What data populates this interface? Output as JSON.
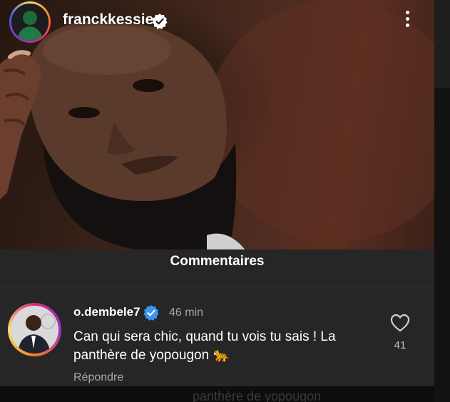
{
  "post": {
    "username": "franckkessie",
    "verified": true,
    "avatar_icon": "profile-avatar",
    "menu_icon": "more-vertical-icon"
  },
  "comments": {
    "title": "Commentaires",
    "items": [
      {
        "username": "o.dembele7",
        "verified": true,
        "time": "46 min",
        "text": "Can qui sera chic, quand tu vois tu sais ! La panthère de yopougon 🐆",
        "reply_label": "Répondre",
        "likes": "41",
        "like_icon": "heart-outline-icon"
      }
    ]
  },
  "background_peek_text": "panthère de yopougon",
  "colors": {
    "panel": "#262626",
    "verified_blue": "#3897f0",
    "muted_text": "#a8a8a8"
  }
}
